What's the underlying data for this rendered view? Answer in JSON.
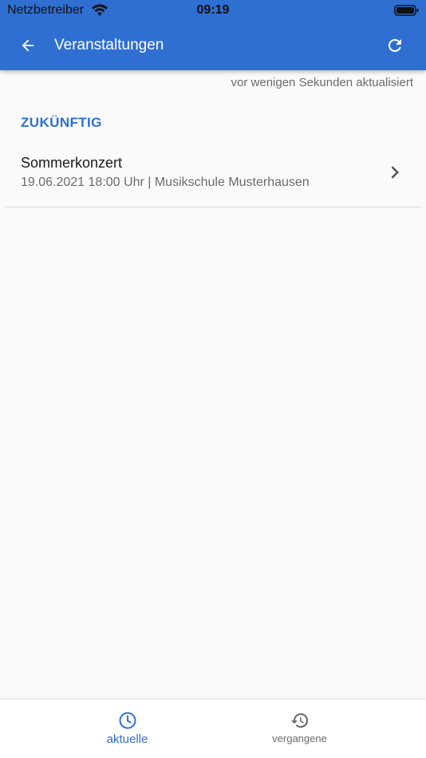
{
  "status_bar": {
    "carrier": "Netzbetreiber",
    "time": "09:19"
  },
  "app_bar": {
    "title": "Veranstaltungen",
    "back_icon": "arrow-left-icon",
    "refresh_icon": "refresh-icon"
  },
  "last_updated": "vor wenigen Sekunden aktualisiert",
  "section": {
    "header": "ZUKÜNFTIG"
  },
  "events": [
    {
      "title": "Sommerkonzert",
      "subtitle": "19.06.2021 18:00 Uhr | Musikschule Musterhausen"
    }
  ],
  "bottom_nav": {
    "tabs": [
      {
        "label": "aktuelle",
        "icon": "clock-icon",
        "active": true
      },
      {
        "label": "vergangene",
        "icon": "history-icon",
        "active": false
      }
    ]
  },
  "colors": {
    "primary": "#2f6fd1",
    "background": "#fafafa",
    "secondary_text": "#6b6b6b"
  }
}
